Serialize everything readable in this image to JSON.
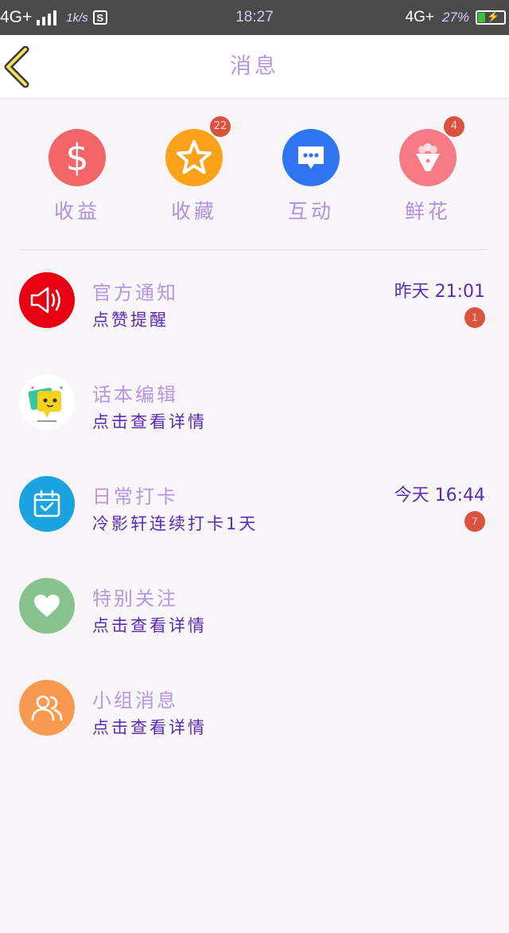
{
  "status_bar": {
    "network_left": "4G+",
    "speed": "1k/s",
    "s_icon": "S",
    "time": "18:27",
    "network_right": "4G+",
    "battery_percent": "27%",
    "battery_level": 0.27
  },
  "header": {
    "back_icon": "chevron-left-icon",
    "title": "消息"
  },
  "quick_items": [
    {
      "label": "收益",
      "icon": "dollar-icon",
      "color": "#f26667",
      "badge": ""
    },
    {
      "label": "收藏",
      "icon": "star-icon",
      "color": "#fba21a",
      "badge": "22"
    },
    {
      "label": "互动",
      "icon": "chat-bubble-icon",
      "color": "#2f74f0",
      "badge": ""
    },
    {
      "label": "鲜花",
      "icon": "bouquet-icon",
      "color": "#f77b87",
      "badge": "4"
    }
  ],
  "messages": [
    {
      "title": "官方通知",
      "subtitle": "点赞提醒",
      "time": "昨天 21:01",
      "badge": "1",
      "icon": "speaker-icon",
      "color": "#e60012"
    },
    {
      "title": "话本编辑",
      "subtitle": "点击查看详情",
      "time": "",
      "badge": "",
      "icon": "editor-avatar-icon",
      "color": "#ffffff"
    },
    {
      "title": "日常打卡",
      "subtitle": "冷影轩连续打卡1天",
      "time": "今天 16:44",
      "badge": "7",
      "icon": "calendar-check-icon",
      "color": "#1ba3e0"
    },
    {
      "title": "特别关注",
      "subtitle": "点击查看详情",
      "time": "",
      "badge": "",
      "icon": "heart-icon",
      "color": "#88c38f"
    },
    {
      "title": "小组消息",
      "subtitle": "点击查看详情",
      "time": "",
      "badge": "",
      "icon": "group-icon",
      "color": "#f99a50"
    }
  ]
}
